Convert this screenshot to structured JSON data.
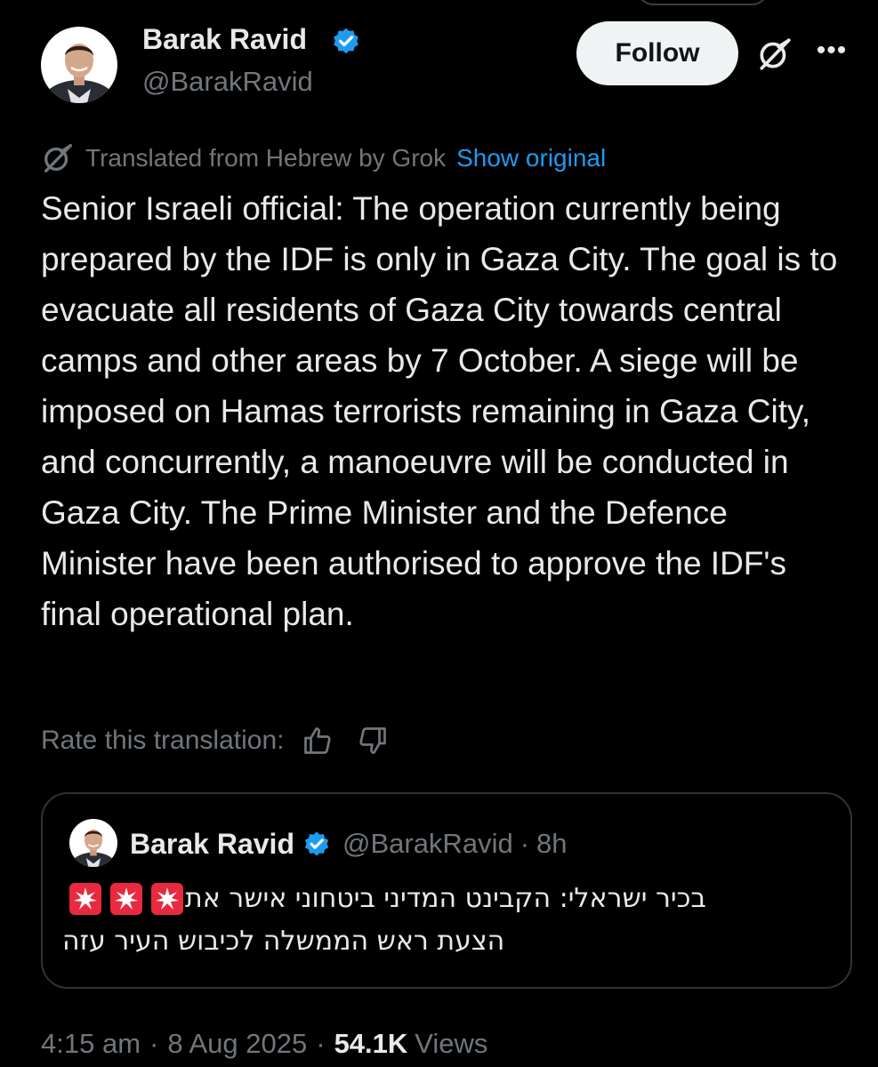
{
  "header": {
    "author_name": "Barak Ravid",
    "author_handle": "@BarakRavid",
    "follow_label": "Follow",
    "more_glyph": "•••"
  },
  "translation": {
    "note": "Translated from Hebrew by Grok",
    "show_original": "Show original"
  },
  "tweet": {
    "text": "Senior Israeli official: The operation currently being prepared by the IDF is only in Gaza City. The goal is to evacuate all residents of Gaza City towards central camps and other areas by 7 October. A siege will be imposed on Hamas terrorists remaining in Gaza City, and concurrently, a manoeuvre will be conducted in Gaza City. The Prime Minister and the Defence Minister have been authorised to approve the IDF's final operational plan."
  },
  "rating": {
    "label": "Rate this translation:"
  },
  "quote": {
    "author_name": "Barak Ravid",
    "author_handle": "@BarakRavid",
    "separator": "·",
    "time": "8h",
    "line1": "בכיר ישראלי: הקבינט המדיני ביטחוני אישר את",
    "line2": "הצעת ראש הממשלה לכיבוש העיר עזה"
  },
  "meta": {
    "time": "4:15 am",
    "separator": "·",
    "date": "8 Aug 2025",
    "views_count": "54.1K",
    "views_label": "Views"
  },
  "colors": {
    "background": "#000000",
    "text_primary": "#e7e9ea",
    "text_secondary": "#71767b",
    "link": "#1d9bf0",
    "verified": "#1d9bf0",
    "border": "#2f3336",
    "follow_bg": "#eff3f4"
  },
  "icons": {
    "verified": "verified-badge-icon",
    "grok": "grok-icon",
    "more": "more-icon",
    "thumbs_up": "thumbs-up-icon",
    "thumbs_down": "thumbs-down-icon",
    "siren": "siren-emoji-icon"
  }
}
